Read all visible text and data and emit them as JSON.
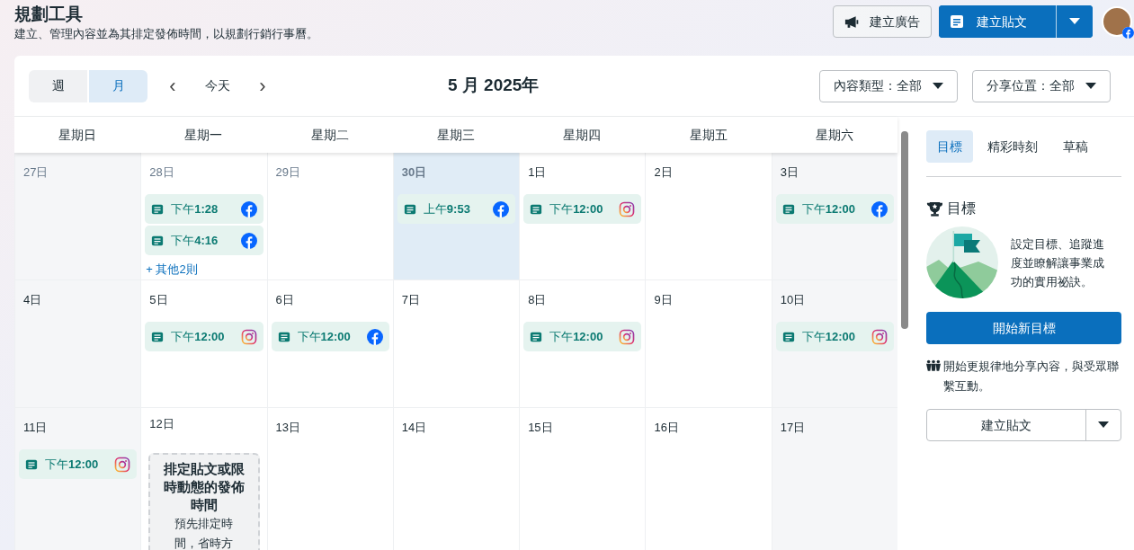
{
  "header": {
    "title": "規劃工具",
    "subtitle": "建立、管理內容並為其排定發佈時間，以規劃行銷行事曆。",
    "buttons": [
      {
        "kind": "ad",
        "label": "建立廣告"
      },
      {
        "kind": "post",
        "label": "建立貼文"
      }
    ]
  },
  "toolbar": {
    "view_tabs": [
      {
        "label": "週",
        "selected": false
      },
      {
        "label": "月",
        "selected": true
      }
    ],
    "today": "今天",
    "prev": "‹",
    "next": "›",
    "month": "5 月 2025年",
    "filters": [
      "內容類型：全部",
      "分享位置：全部"
    ]
  },
  "weekdays": [
    "星期日",
    "星期一",
    "星期二",
    "星期三",
    "星期四",
    "星期五",
    "星期六"
  ],
  "weeks": [
    [
      {
        "day": "27日",
        "outside": true
      },
      {
        "day": "28日",
        "outside": true,
        "posts": [
          {
            "time": "下午**1:28**",
            "kind": "facebook"
          },
          {
            "time": "下午**4:16**",
            "kind": "facebook"
          }
        ],
        "more": "+ 其他2則"
      },
      {
        "day": "29日",
        "outside": true
      },
      {
        "day": "30日",
        "outside": true,
        "today": true,
        "posts": [
          {
            "time": "上午**9:53**",
            "kind": "facebook"
          }
        ]
      },
      {
        "day": "1日",
        "posts": [
          {
            "time": "下午**12:00**",
            "kind": "instagram"
          }
        ]
      },
      {
        "day": "2日"
      },
      {
        "day": "3日",
        "posts": [
          {
            "time": "下午**12:00**",
            "kind": "facebook"
          }
        ]
      }
    ],
    [
      {
        "day": "4日"
      },
      {
        "day": "5日",
        "posts": [
          {
            "time": "下午**12:00**",
            "kind": "instagram"
          }
        ]
      },
      {
        "day": "6日",
        "posts": [
          {
            "time": "下午**12:00**",
            "kind": "facebook"
          }
        ]
      },
      {
        "day": "7日"
      },
      {
        "day": "8日",
        "posts": [
          {
            "time": "下午**12:00**",
            "kind": "instagram"
          }
        ]
      },
      {
        "day": "9日"
      },
      {
        "day": "10日",
        "posts": [
          {
            "time": "下午**12:00**",
            "kind": "instagram"
          }
        ]
      }
    ],
    [
      {
        "day": "11日",
        "posts": [
          {
            "time": "下午**12:00**",
            "kind": "instagram"
          }
        ]
      },
      {
        "day": "12日",
        "promo": {
          "title": "排定貼文或限時動態的發佈時間",
          "text": "預先排定時間，省時方"
        }
      },
      {
        "day": "13日"
      },
      {
        "day": "14日"
      },
      {
        "day": "15日"
      },
      {
        "day": "16日"
      },
      {
        "day": "17日"
      }
    ]
  ],
  "side_panel": {
    "tabs": [
      {
        "label": "目標",
        "selected": true
      },
      {
        "label": "精彩時刻",
        "selected": false
      },
      {
        "label": "草稿",
        "selected": false
      }
    ],
    "goal_title": "目標",
    "goal_text": "設定目標、追蹤進度並瞭解讓事業成功的實用祕訣。",
    "goal_button": "開始新目標",
    "tip": "開始更規律地分享內容，與受眾聯繫互動。",
    "create_button": "建立貼文"
  }
}
